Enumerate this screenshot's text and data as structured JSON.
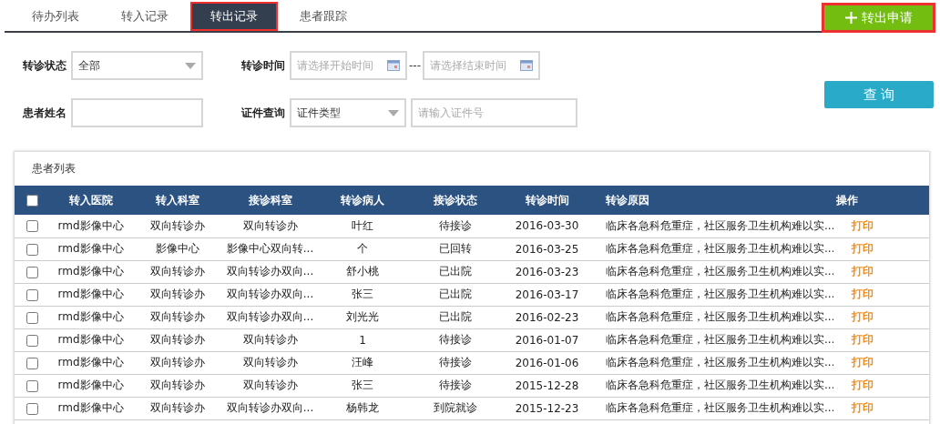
{
  "tabs": [
    {
      "label": "待办列表",
      "selected": false,
      "highlighted": false
    },
    {
      "label": "转入记录",
      "selected": false,
      "highlighted": false
    },
    {
      "label": "转出记录",
      "selected": true,
      "highlighted": true
    },
    {
      "label": "患者跟踪",
      "selected": false,
      "highlighted": false
    }
  ],
  "add_button": {
    "label": "转出申请",
    "highlighted": true
  },
  "filters": {
    "status": {
      "label": "转诊状态",
      "value": "全部"
    },
    "time": {
      "label": "转诊时间",
      "start_placeholder": "请选择开始时间",
      "separator": "---",
      "end_placeholder": "请选择结束时间"
    },
    "name": {
      "label": "患者姓名"
    },
    "id": {
      "label": "证件查询",
      "type_value": "证件类型",
      "placeholder": "请输入证件号"
    },
    "search_button": "查 询"
  },
  "table": {
    "title": "患者列表",
    "select_all": {
      "checked": false
    },
    "columns": [
      "转入医院",
      "转入科室",
      "接诊科室",
      "转诊病人",
      "接诊状态",
      "转诊时间",
      "转诊原因",
      "操作"
    ],
    "rows": [
      {
        "checked": false,
        "cells": [
          "rmd影像中心",
          "双向转诊办",
          "双向转诊办",
          "叶红",
          "待接诊",
          "2016-03-30",
          "临床各急科危重症，社区服务卫生机构难以实...",
          "打印"
        ]
      },
      {
        "checked": false,
        "cells": [
          "rmd影像中心",
          "影像中心",
          "影像中心双向转...",
          "个",
          "已回转",
          "2016-03-25",
          "临床各急科危重症，社区服务卫生机构难以实...",
          "打印"
        ]
      },
      {
        "checked": false,
        "cells": [
          "rmd影像中心",
          "双向转诊办",
          "双向转诊办双向...",
          "舒小桃",
          "已出院",
          "2016-03-23",
          "临床各急科危重症，社区服务卫生机构难以实...",
          "打印"
        ]
      },
      {
        "checked": false,
        "cells": [
          "rmd影像中心",
          "双向转诊办",
          "双向转诊办双向...",
          "张三",
          "已出院",
          "2016-03-17",
          "临床各急科危重症，社区服务卫生机构难以实...",
          "打印"
        ]
      },
      {
        "checked": false,
        "cells": [
          "rmd影像中心",
          "双向转诊办",
          "双向转诊办双向...",
          "刘光光",
          "已出院",
          "2016-02-23",
          "临床各急科危重症，社区服务卫生机构难以实...",
          "打印"
        ]
      },
      {
        "checked": false,
        "cells": [
          "rmd影像中心",
          "双向转诊办",
          "双向转诊办",
          "1",
          "待接诊",
          "2016-01-07",
          "临床各急科危重症，社区服务卫生机构难以实...",
          "打印"
        ]
      },
      {
        "checked": false,
        "cells": [
          "rmd影像中心",
          "双向转诊办",
          "双向转诊办",
          "汪峰",
          "待接诊",
          "2016-01-06",
          "临床各急科危重症，社区服务卫生机构难以实...",
          "打印"
        ]
      },
      {
        "checked": false,
        "cells": [
          "rmd影像中心",
          "双向转诊办",
          "双向转诊办",
          "张三",
          "待接诊",
          "2015-12-28",
          "临床各急科危重症，社区服务卫生机构难以实...",
          "打印"
        ]
      },
      {
        "checked": false,
        "cells": [
          "rmd影像中心",
          "双向转诊办",
          "双向转诊办双向...",
          "杨韩龙",
          "到院就诊",
          "2015-12-23",
          "临床各急科危重症，社区服务卫生机构难以实...",
          "打印"
        ]
      }
    ]
  }
}
